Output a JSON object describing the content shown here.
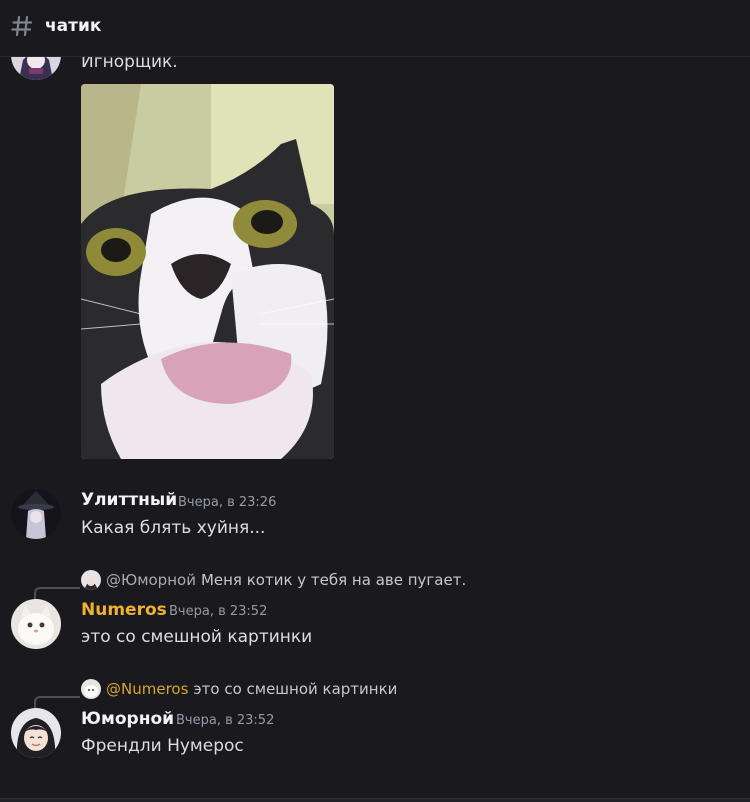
{
  "channel": {
    "name": "чатик",
    "icon": "hash-icon"
  },
  "messages": [
    {
      "author": "",
      "text": "Игнорщик.",
      "attachment": "cat-gif"
    },
    {
      "author": "Улиттный",
      "timestamp": "Вчера, в 23:26",
      "text": "Какая блять хуйня..."
    },
    {
      "reply": {
        "mention": "@Юморной",
        "text": "Меня котик у тебя на аве пугает."
      },
      "author": "Numeros",
      "author_color": "#f0b132",
      "timestamp": "Вчера, в 23:52",
      "text": "это со смешной картинки"
    },
    {
      "reply": {
        "mention": "@Numeros",
        "text": "это со смешной картинки"
      },
      "author": "Юморной",
      "timestamp": "Вчера, в 23:52",
      "text": "Френдли Нумерос"
    }
  ],
  "colors": {
    "background": "#1a1a1e",
    "numeros": "#f0b132",
    "mention_gold": "#d4a62a"
  }
}
